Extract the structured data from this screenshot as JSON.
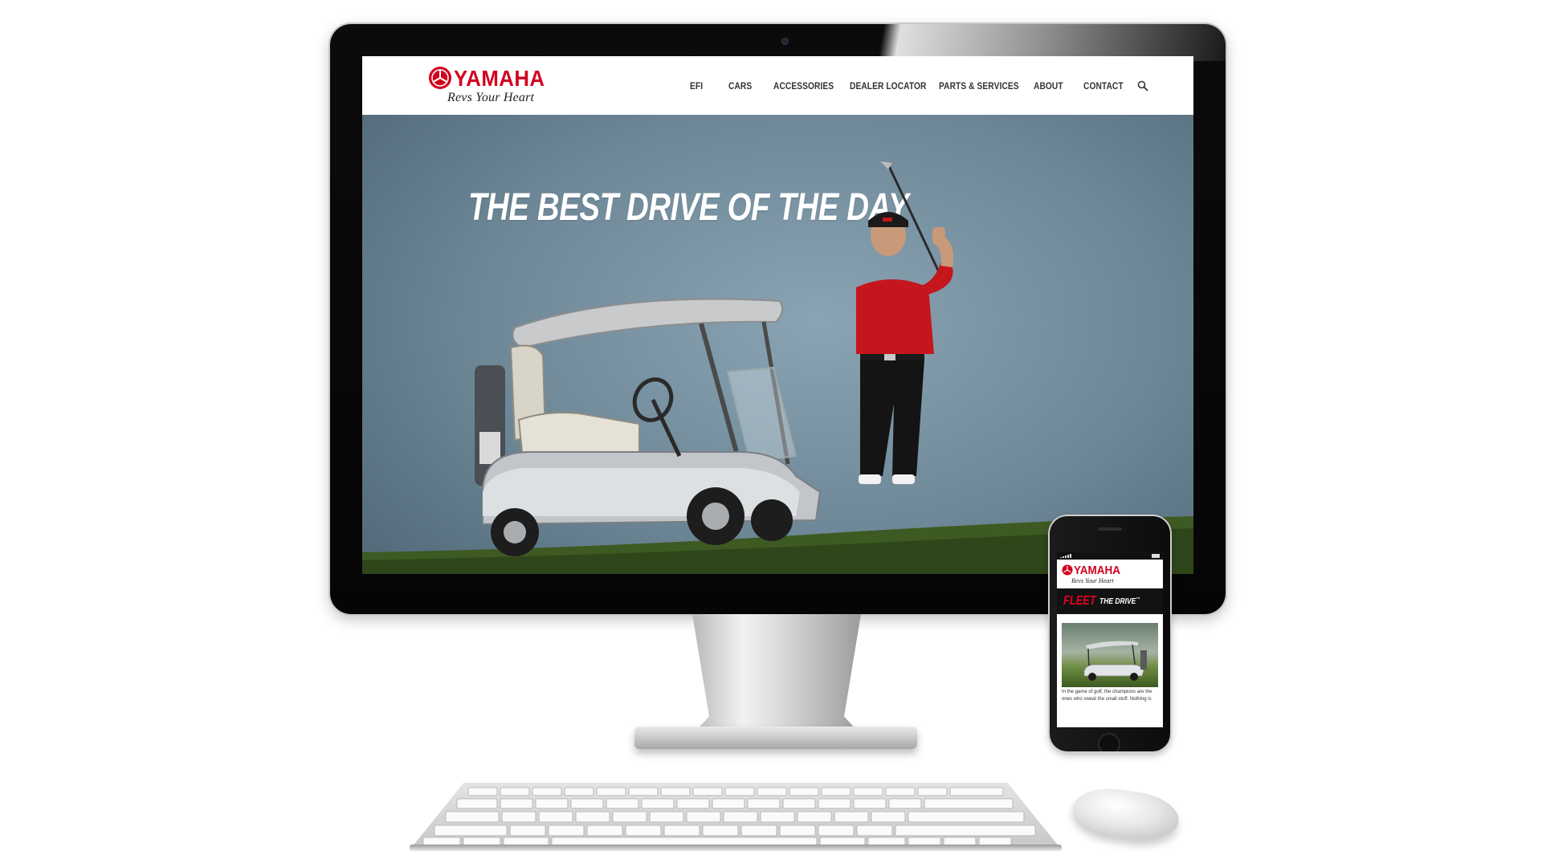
{
  "site": {
    "brand": "YAMAHA",
    "tagline": "Revs Your Heart",
    "brand_color": "#d2001f"
  },
  "nav": {
    "items": [
      {
        "label": "EFI",
        "name": "nav-efi"
      },
      {
        "label": "CARS",
        "name": "nav-cars"
      },
      {
        "label": "ACCESSORIES",
        "name": "nav-accessories"
      },
      {
        "label": "DEALER LOCATOR",
        "name": "nav-dealer-locator"
      },
      {
        "label": "PARTS & SERVICES",
        "name": "nav-parts-services"
      },
      {
        "label": "ABOUT",
        "name": "nav-about"
      },
      {
        "label": "CONTACT",
        "name": "nav-contact"
      }
    ],
    "search_icon": "search-icon"
  },
  "hero": {
    "headline": "THE BEST DRIVE OF THE DAY"
  },
  "mobile": {
    "brand": "YAMAHA",
    "tagline": "Revs Your Heart",
    "banner_fleet": "FLEET",
    "banner_drive": "THE DRIVE",
    "banner_trademark": "™",
    "body_text": "In the game of golf, the champions are the ones who sweat the small stuff. Nothing is"
  }
}
